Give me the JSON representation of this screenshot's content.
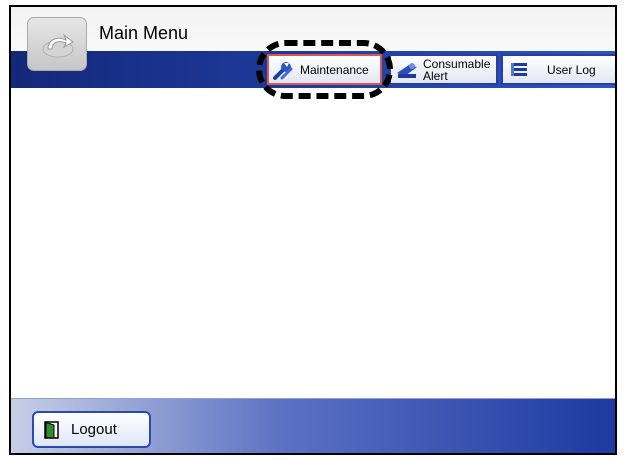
{
  "header": {
    "title": "Main Menu",
    "back_icon": "back-arrow-icon"
  },
  "tabs": [
    {
      "label": "Maintenance",
      "icon": "wrench-icon",
      "highlighted": true
    },
    {
      "label_line1": "Consumable",
      "label_line2": "Alert",
      "icon": "scanner-alert-icon"
    },
    {
      "label": "User Log",
      "icon": "list-icon"
    }
  ],
  "footer": {
    "logout_label": "Logout",
    "logout_icon": "door-icon"
  },
  "colors": {
    "header_bar": "#1d3a9a",
    "tab_border": "#2a3f9c",
    "highlight_tab_border": "#d9574f",
    "footer_accent": "#1d3aa2"
  }
}
